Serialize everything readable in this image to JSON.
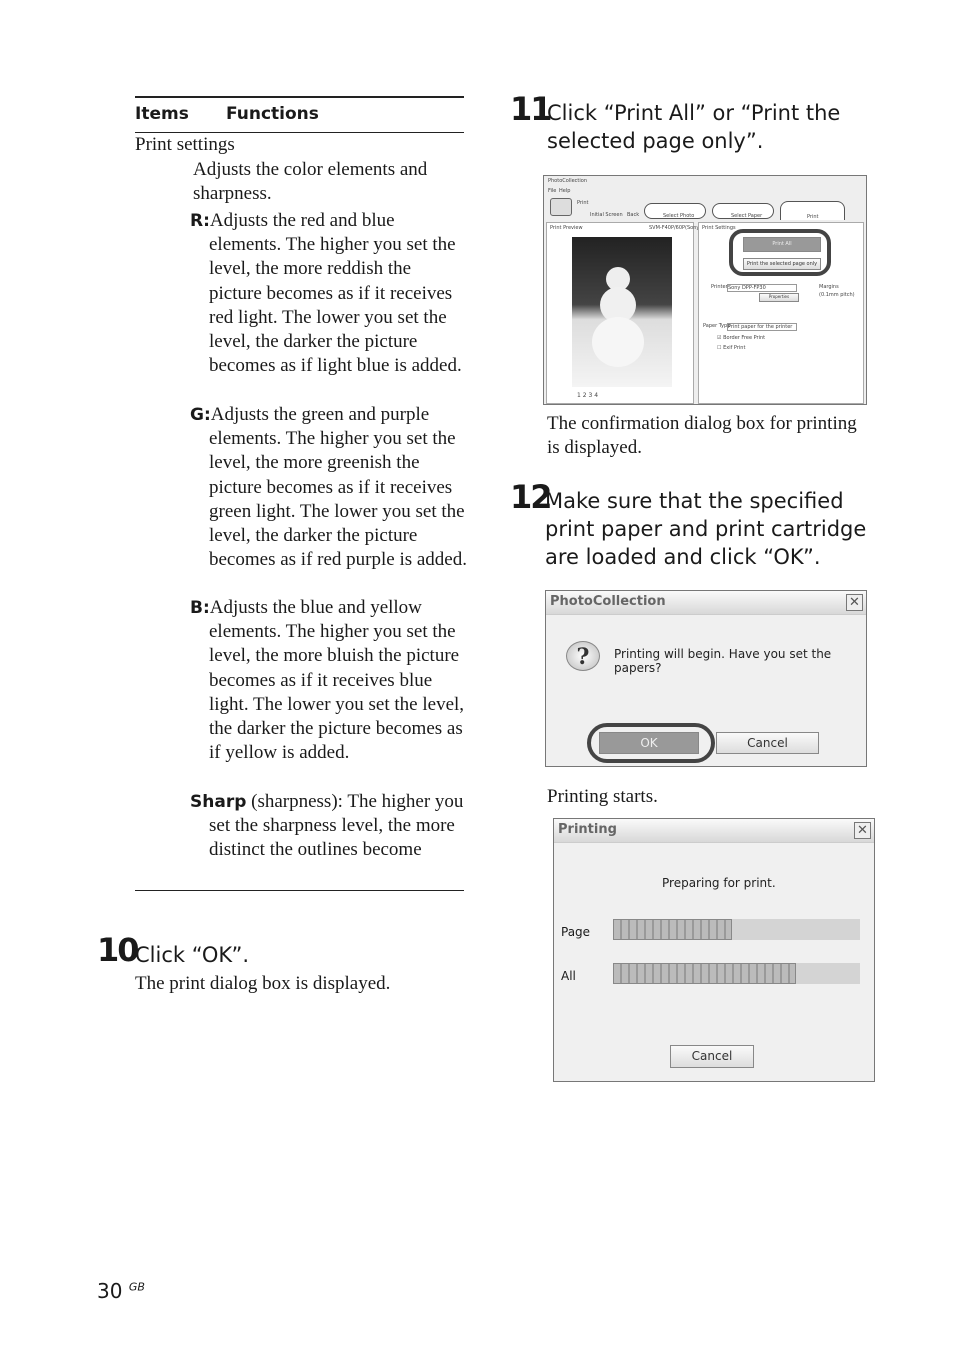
{
  "table": {
    "header_items": "Items",
    "header_functions": "Functions",
    "row_label": "Print settings",
    "intro": "Adjusts the color elements and sharpness.",
    "entries": [
      {
        "label": "R:",
        "text": "Adjusts the red and blue elements.  The higher you set the level, the more reddish the picture becomes as if it receives red light.  The lower you set the level, the darker the picture becomes as if light blue is added."
      },
      {
        "label": "G:",
        "text": "Adjusts the green and purple elements.  The higher you set the level, the more greenish the picture becomes as if it receives green light.  The lower you set the level, the darker the picture becomes as if red purple is added."
      },
      {
        "label": "B:",
        "text": "Adjusts the blue and yellow elements.  The higher you set the level, the more bluish the picture becomes as if it receives blue light.  The lower you set the level, the darker the picture becomes as if yellow is added."
      },
      {
        "label": "Sharp",
        "label_suffix": " (sharpness):",
        "text": "  The higher you set the sharpness level, the more distinct the outlines become"
      }
    ]
  },
  "step10": {
    "number": "10",
    "instruction": "Click “OK”.",
    "result": "The print dialog box is displayed."
  },
  "step11": {
    "number": "11",
    "instruction": "Click “Print All” or “Print the selected page only”.",
    "result": "The confirmation dialog box for printing is displayed.",
    "screen": {
      "title": "PhotoCollection",
      "menu": [
        "File",
        "Help"
      ],
      "mode": "Print",
      "initial_screen": "Initial Screen",
      "back": "Back",
      "tabs": [
        "Select Photo",
        "Select Paper",
        "Print"
      ],
      "preview_label": "Print Preview",
      "printer_id": "SVM-F40P/60P(Sony)",
      "settings_label": "Print Settings",
      "print_all": "Print All",
      "print_selected": "Print the selected page only",
      "printer_label": "Printer",
      "printer_value": "Sony DPP-FP30",
      "properties": "Properties",
      "margins": "Margins",
      "margins_sub": "(0.1mm pitch)",
      "paper_type_label": "Paper Type",
      "paper_type_value": "Print paper for the printer",
      "border_free": "Border Free Print",
      "border_free_checked": true,
      "exif": "Exif Print",
      "exif_checked": false,
      "pages": [
        "1",
        "2",
        "3",
        "4"
      ]
    }
  },
  "step12": {
    "number": "12",
    "instruction": "Make sure that the specified print paper and print cartridge are loaded and click “OK”.",
    "dialog": {
      "title": "PhotoCollection",
      "message": "Printing will begin.  Have you set the papers?",
      "ok": "OK",
      "cancel": "Cancel"
    },
    "result": "Printing starts.",
    "progress": {
      "title": "Printing",
      "status": "Preparing for print.",
      "page_label": "Page",
      "page_progress": 0.48,
      "all_label": "All",
      "all_progress": 0.74,
      "cancel": "Cancel"
    }
  },
  "footer": {
    "page_number": "30",
    "region": "GB"
  }
}
